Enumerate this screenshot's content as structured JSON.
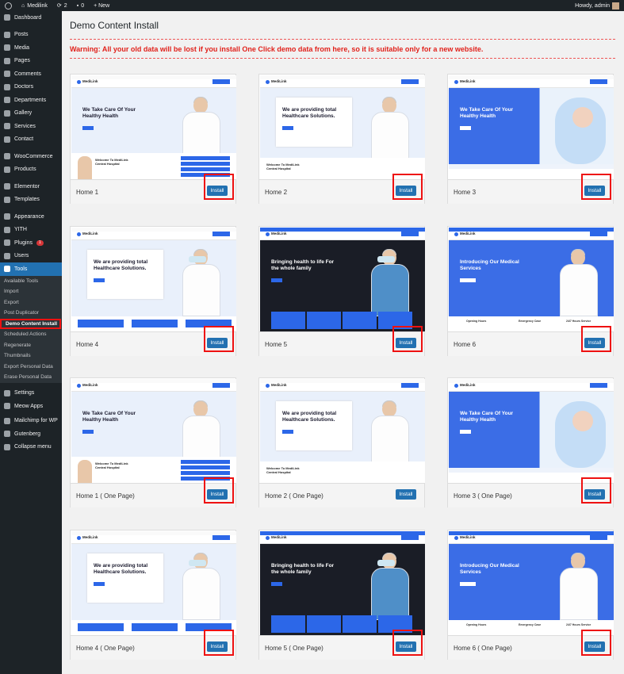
{
  "adminbar": {
    "site": "Medilink",
    "updates": "2",
    "comments": "0",
    "new": "+ New",
    "howdy": "Howdy, admin"
  },
  "sidebar": {
    "items": [
      {
        "label": "Dashboard",
        "icon": "dashboard-icon"
      },
      {
        "label": "Posts",
        "icon": "pin-icon"
      },
      {
        "label": "Media",
        "icon": "media-icon"
      },
      {
        "label": "Pages",
        "icon": "pages-icon"
      },
      {
        "label": "Comments",
        "icon": "comments-icon"
      },
      {
        "label": "Doctors",
        "icon": "doctors-icon"
      },
      {
        "label": "Departments",
        "icon": "departments-icon"
      },
      {
        "label": "Gallery",
        "icon": "gallery-icon"
      },
      {
        "label": "Services",
        "icon": "services-icon"
      },
      {
        "label": "Contact",
        "icon": "contact-icon"
      },
      {
        "label": "WooCommerce",
        "icon": "woocommerce-icon"
      },
      {
        "label": "Products",
        "icon": "products-icon"
      },
      {
        "label": "Elementor",
        "icon": "elementor-icon"
      },
      {
        "label": "Templates",
        "icon": "templates-icon"
      },
      {
        "label": "Appearance",
        "icon": "appearance-icon"
      },
      {
        "label": "YITH",
        "icon": "yith-icon"
      },
      {
        "label": "Plugins",
        "icon": "plugins-icon",
        "badge": "1"
      },
      {
        "label": "Users",
        "icon": "users-icon"
      },
      {
        "label": "Tools",
        "icon": "tools-icon"
      }
    ],
    "submenu": [
      "Available Tools",
      "Import",
      "Export",
      "Post Duplicator",
      "Demo Content Install",
      "Scheduled Actions",
      "Regenerate",
      "Thumbnails",
      "Export Personal Data",
      "Erase Personal Data"
    ],
    "items2": [
      {
        "label": "Settings",
        "icon": "settings-icon"
      },
      {
        "label": "Meow Apps",
        "icon": "meow-apps-icon"
      },
      {
        "label": "Mailchimp for WP",
        "icon": "mailchimp-icon"
      },
      {
        "label": "Gutenberg",
        "icon": "gutenberg-icon"
      },
      {
        "label": "Collapse menu",
        "icon": "collapse-icon"
      }
    ]
  },
  "page": {
    "title": "Demo Content Install",
    "warning": "Warning: All your old data will be lost if you install One Click demo data from here, so it is suitable only for a new website.",
    "install_label": "Install"
  },
  "demos": [
    {
      "name": "Home 1",
      "variant": "doctor"
    },
    {
      "name": "Home 2",
      "variant": "doctor2"
    },
    {
      "name": "Home 3",
      "variant": "baby"
    },
    {
      "name": "Home 4",
      "variant": "lab"
    },
    {
      "name": "Home 5",
      "variant": "dark"
    },
    {
      "name": "Home 6",
      "variant": "blue"
    },
    {
      "name": "Home 1 ( One Page)",
      "variant": "doctor"
    },
    {
      "name": "Home 2 ( One Page)",
      "variant": "doctor2"
    },
    {
      "name": "Home 3 ( One Page)",
      "variant": "baby"
    },
    {
      "name": "Home 4 ( One Page)",
      "variant": "lab"
    },
    {
      "name": "Home 5 ( One Page)",
      "variant": "dark"
    },
    {
      "name": "Home 6 ( One Page)",
      "variant": "blue"
    }
  ],
  "hero_texts": {
    "doctor": "We Take Care Of Your Healthy Health",
    "doctor2": "We are providing total Healthcare Solutions.",
    "baby": "We Take Care Of Your Healthy Health",
    "lab": "We are providing total Healthcare Solutions.",
    "dark": "Bringing health to life For the whole family",
    "blue": "Introducing Our Medical Services"
  },
  "shot_texts": {
    "logo": "MediLink",
    "welcome": "Welcome To MediLink Central Hospital",
    "opening": "Opening Hours",
    "emergency": "Emergency Case",
    "service": "24/7 Hours Service"
  },
  "colors": {
    "accent": "#2271b1",
    "warning": "#e1211b",
    "highlight": "#e11",
    "sidebar": "#1d2327"
  }
}
